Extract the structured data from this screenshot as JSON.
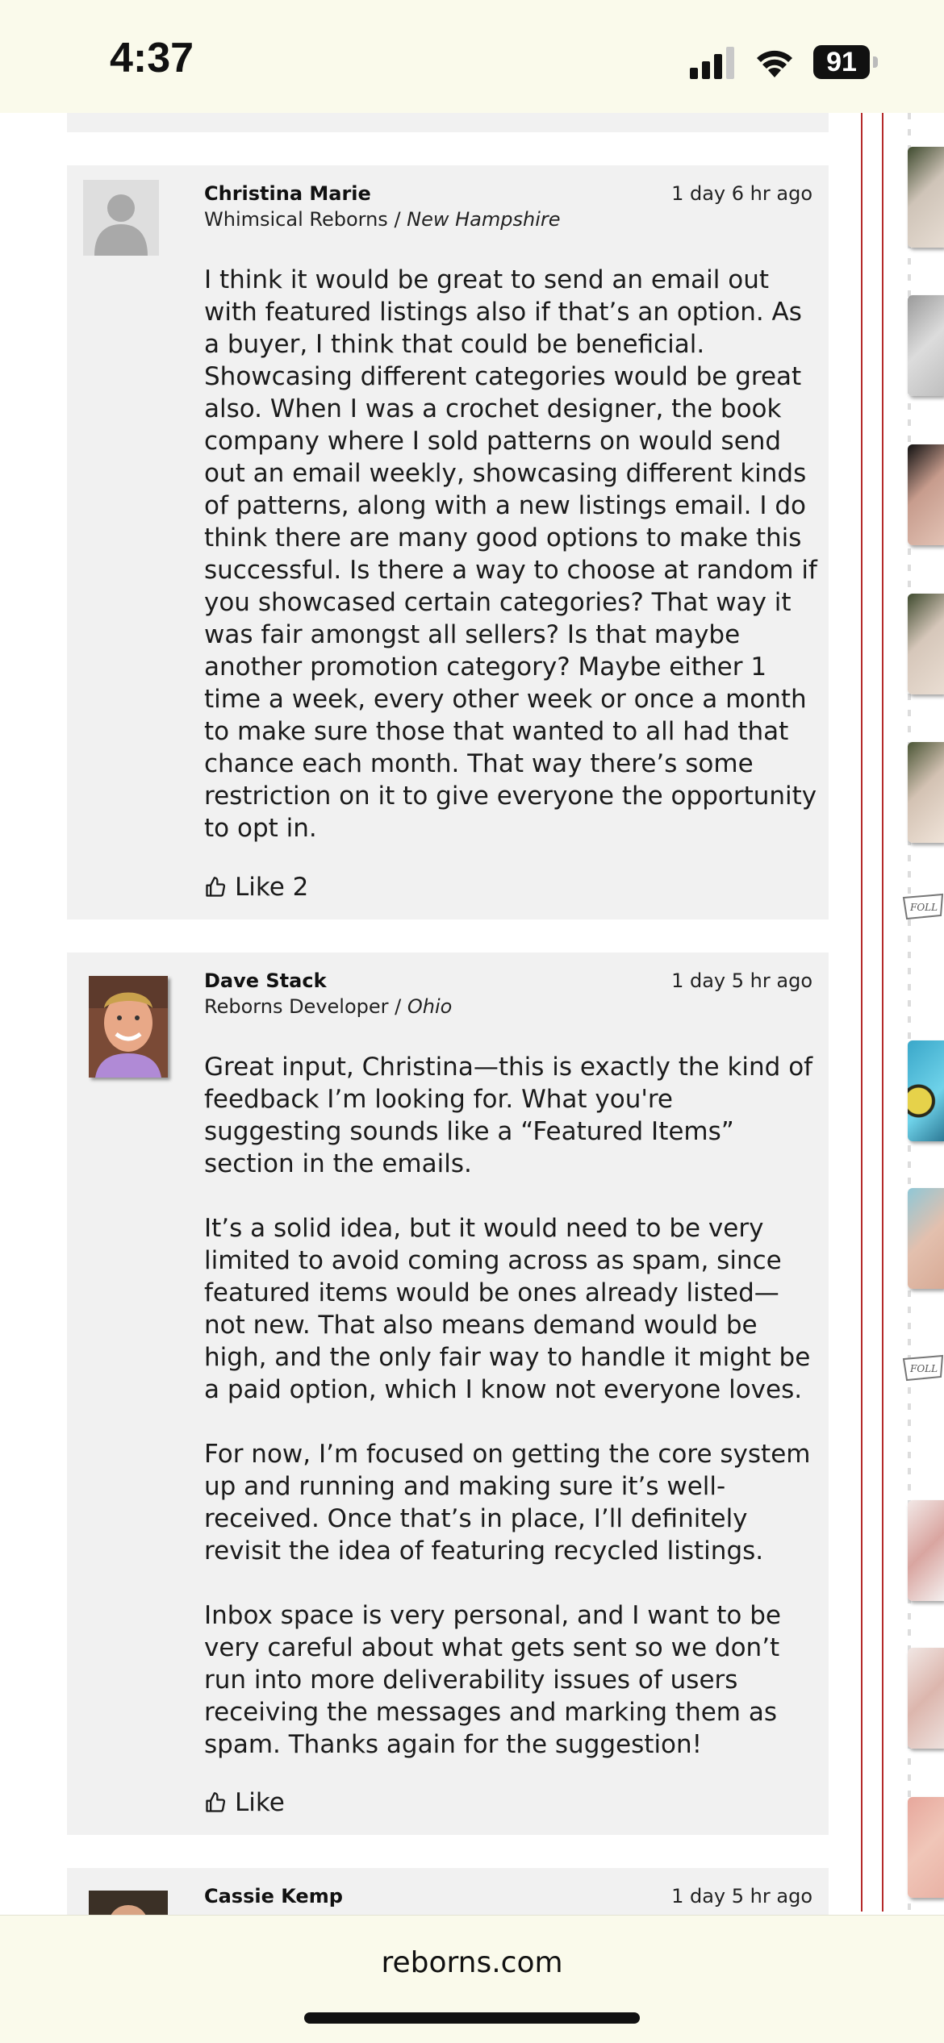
{
  "status_bar": {
    "time": "4:37",
    "battery": "91"
  },
  "comments": [
    {
      "author": "Christina Marie",
      "shop": "Whimsical Reborns",
      "separator": " / ",
      "location": "New Hampshire",
      "time_ago": "1 day 6 hr ago",
      "paragraphs": [
        "I think it would be great to send an email out with featured listings also if that’s an option. As a buyer, I think that could be beneficial. Showcasing different categories would be great also. When I was a crochet designer, the book company where I sold patterns on would send out an email weekly, showcasing different kinds of patterns, along with a new listings email. I do think there are many good options to make this successful. Is there a way to choose at random if you showcased certain categories? That way it was fair amongst all sellers? Is that maybe another promotion category? Maybe either 1 time a week, every other week or once a month to make sure those that wanted to all had that chance each month. That way there’s some restriction on it to give everyone the opportunity to opt in."
      ],
      "like_label": "Like 2"
    },
    {
      "author": "Dave Stack",
      "shop": "Reborns Developer",
      "separator": " / ",
      "location": "Ohio",
      "time_ago": "1 day 5 hr ago",
      "paragraphs": [
        "Great input, Christina—this is exactly the kind of feedback I’m looking for. What you're suggesting sounds like a “Featured Items” section in the emails.",
        "It’s a solid idea, but it would need to be very limited to avoid coming across as spam, since featured items would be ones already listed—not new. That also means demand would be high, and the only fair way to handle it might be a paid option, which I know not everyone loves.",
        "For now, I’m focused on getting the core system up and running and making sure it’s well-received. Once that’s in place, I’ll definitely revisit the idea of featuring recycled listings.",
        "Inbox space is very personal, and I want to be very careful about what gets sent so we don’t run into more deliverability issues of users receiving the messages and marking them as spam. Thanks again for the suggestion!"
      ],
      "like_label": "Like"
    },
    {
      "author": "Cassie Kemp",
      "time_ago": "1 day 5 hr ago"
    }
  ],
  "side_tags": [
    "FOLL",
    "FOLL"
  ],
  "browser": {
    "url": "reborns.com"
  }
}
